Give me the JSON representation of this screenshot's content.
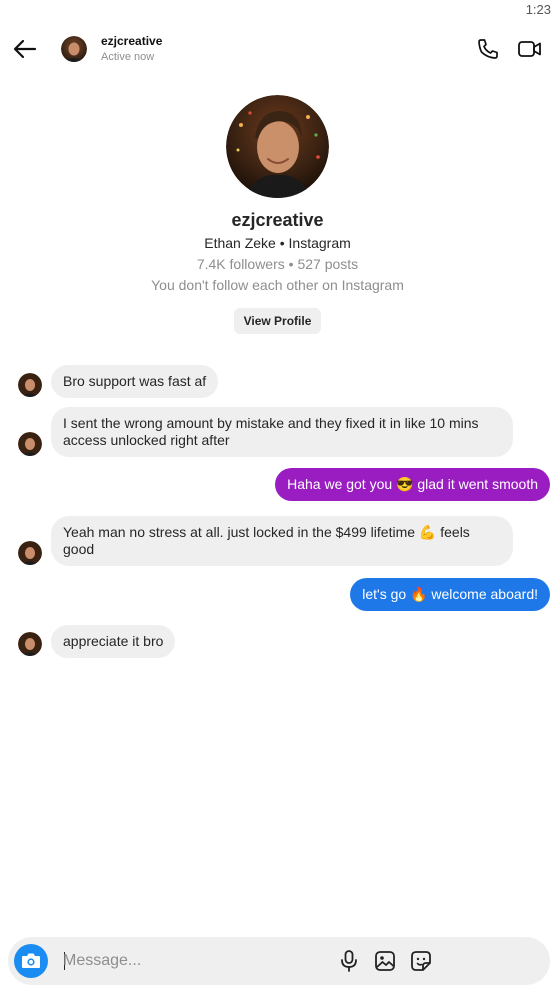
{
  "status_bar": {
    "time": "1:23"
  },
  "header": {
    "username": "ezjcreative",
    "status": "Active now",
    "back_icon": "arrow-left-icon",
    "call_icon": "phone-icon",
    "video_icon": "video-camera-icon"
  },
  "profile": {
    "username": "ezjcreative",
    "meta": "Ethan Zeke • Instagram",
    "stats": "7.4K followers • 527 posts",
    "follow_status": "You don't follow each other on Instagram",
    "view_profile_label": "View Profile"
  },
  "messages": [
    {
      "direction": "incoming",
      "text": "Bro support was fast af"
    },
    {
      "direction": "incoming",
      "text": "I sent the wrong amount by mistake and they fixed it in like 10 mins  access unlocked right after"
    },
    {
      "direction": "outgoing",
      "text": "Haha we got you 😎 glad it went smooth"
    },
    {
      "direction": "incoming",
      "text": "Yeah man no stress at all. just locked in the $499 lifetime 💪 feels good"
    },
    {
      "direction": "outgoing",
      "text": "let's go 🔥 welcome aboard!"
    },
    {
      "direction": "incoming",
      "text": "appreciate it bro"
    }
  ],
  "composer": {
    "placeholder": "Message...",
    "camera_icon": "camera-icon",
    "mic_icon": "microphone-icon",
    "image_icon": "gallery-icon",
    "sticker_icon": "sticker-icon"
  },
  "colors": {
    "outgoing_purple": "#9a1dc2",
    "outgoing_blue": "#1f78e8",
    "incoming_bubble": "#efefef",
    "camera_button": "#1b8cf2"
  }
}
